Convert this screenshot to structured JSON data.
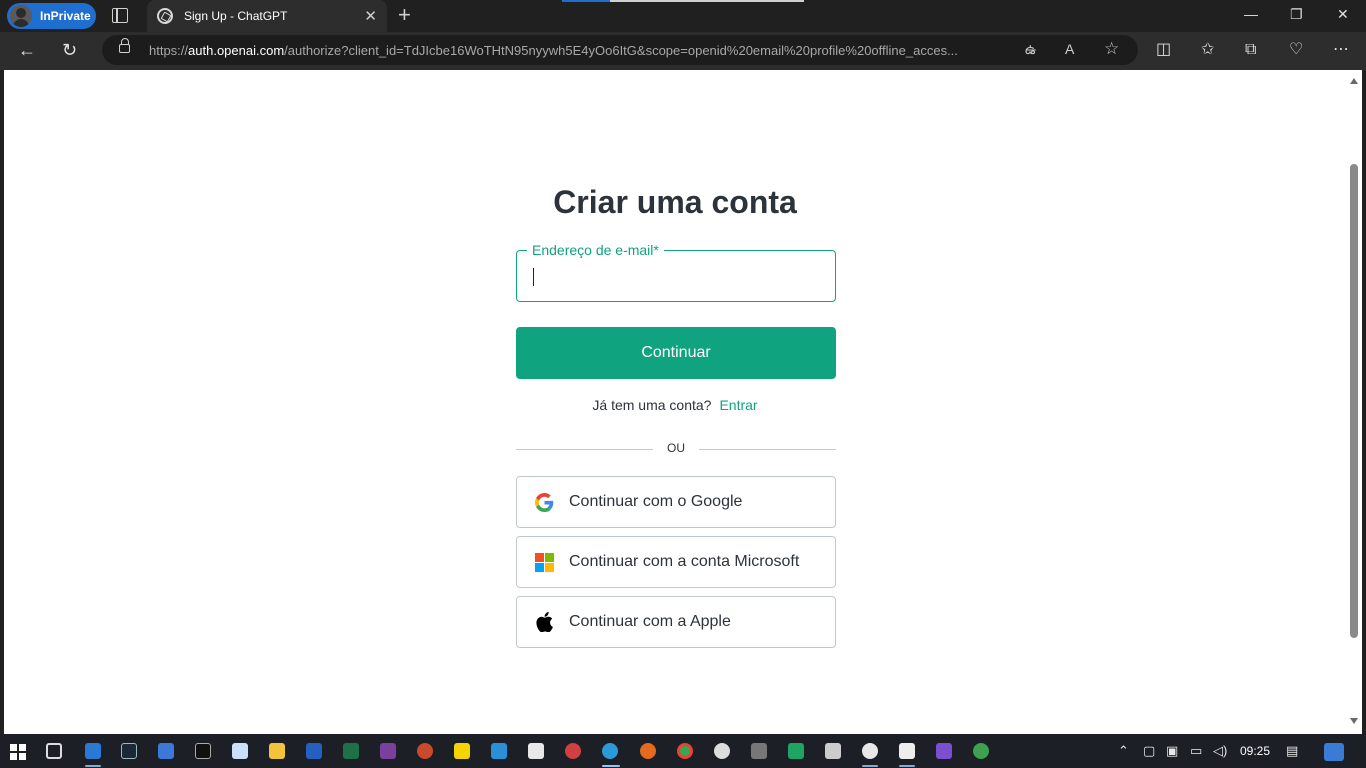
{
  "browser": {
    "inprivate_label": "InPrivate",
    "tab_title": "Sign Up - ChatGPT",
    "url_scheme": "https://",
    "url_host": "auth.openai.com",
    "url_path": "/authorize?client_id=TdJIcbe16WoTHtN95nyywh5E4yOo6ItG&scope=openid%20email%20profile%20offline_acces..."
  },
  "page": {
    "heading": "Criar uma conta",
    "email_label": "Endereço de e-mail*",
    "email_value": "",
    "continue_label": "Continuar",
    "have_account_text": "Já tem uma conta?",
    "login_link": "Entrar",
    "divider_text": "OU",
    "google_label": "Continuar com o Google",
    "microsoft_label": "Continuar com a conta Microsoft",
    "apple_label": "Continuar com a Apple"
  },
  "taskbar": {
    "clock": "09:25"
  },
  "colors": {
    "accent": "#10a37f",
    "inprivate": "#1f6fd0",
    "text": "#2d333a"
  }
}
